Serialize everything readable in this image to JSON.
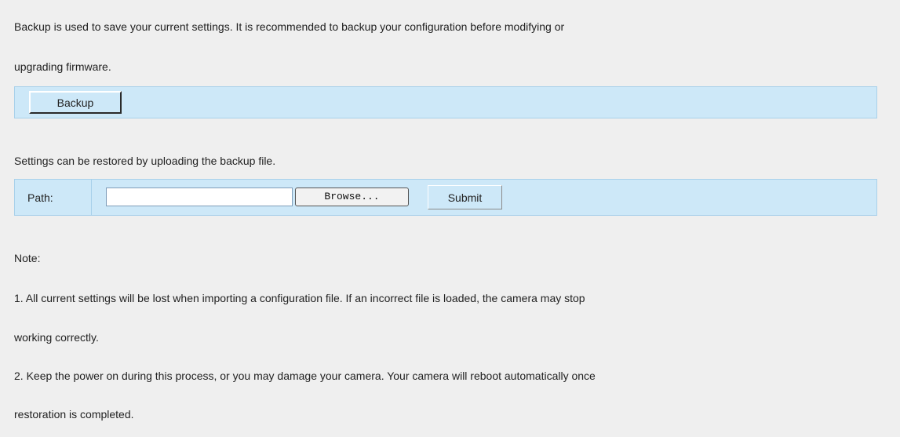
{
  "backup": {
    "description_line1": "Backup is used to save your current settings. It is recommended to backup your configuration before modifying or",
    "description_line2": "upgrading firmware.",
    "button_label": "Backup"
  },
  "restore": {
    "description": "Settings can be restored by uploading the backup file.",
    "path_label": "Path:",
    "path_value": "",
    "browse_label": "Browse...",
    "submit_label": "Submit"
  },
  "note": {
    "heading": "Note:",
    "item1_line1": "1. All current settings will be lost when importing a configuration file. If an incorrect file is loaded, the camera may stop",
    "item1_line2": "working correctly.",
    "item2_line1": "2. Keep the power on during this process, or you may damage your camera. Your camera will reboot automatically once",
    "item2_line2": "restoration is completed."
  }
}
